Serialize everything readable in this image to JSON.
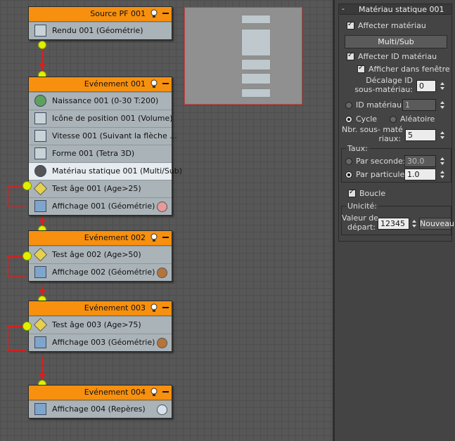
{
  "flow": {
    "events": [
      {
        "title": "Source PF 001",
        "ops": [
          {
            "label": "Rendu 001 (Géométrie)",
            "icon": "render-teapot-icon"
          }
        ]
      },
      {
        "title": "Evénement 001",
        "ops": [
          {
            "label": "Naissance 001 (0-30 T:200)",
            "icon": "birth-icon"
          },
          {
            "label": "Icône de position 001 (Volume)",
            "icon": "position-icon"
          },
          {
            "label": "Vitesse 001 (Suivant la flèche ...",
            "icon": "speed-icon"
          },
          {
            "label": "Forme 001 (Tetra 3D)",
            "icon": "shape-icon"
          },
          {
            "label": "Matériau statique 001 (Multi/Sub)",
            "icon": "material-icon",
            "selected": true
          },
          {
            "label": "Test âge 001 (Age>25)",
            "icon": "age-test-icon"
          },
          {
            "label": "Affichage 001 (Géométrie)",
            "icon": "display-icon",
            "swatch": "#e79a9a"
          }
        ]
      },
      {
        "title": "Evénement 002",
        "ops": [
          {
            "label": "Test âge 002 (Age>50)",
            "icon": "age-test-icon"
          },
          {
            "label": "Affichage 002 (Géométrie)",
            "icon": "display-icon",
            "swatch": "#b5753a"
          }
        ]
      },
      {
        "title": "Evénement 003",
        "ops": [
          {
            "label": "Test âge 003 (Age>75)",
            "icon": "age-test-icon"
          },
          {
            "label": "Affichage 003 (Géométrie)",
            "icon": "display-icon",
            "swatch": "#b5753a"
          }
        ]
      },
      {
        "title": "Evénement 004",
        "ops": [
          {
            "label": "Affichage 004 (Repères)",
            "icon": "display-icon",
            "swatch": "#d6e2ee"
          }
        ]
      }
    ],
    "colors": {
      "header": "#f7900e",
      "wire": "#d62020",
      "node": "#dff000",
      "body": "#aab3b8"
    }
  },
  "panel": {
    "title": "Matériau statique 001",
    "collapse": "-",
    "assign_material": {
      "label": "Affecter matériau",
      "checked": true
    },
    "material_button": "Multi/Sub",
    "assign_material_id": {
      "label": "Affecter ID matériau",
      "checked": true
    },
    "show_in_viewport": {
      "label": "Afficher dans fenêtre",
      "checked": true
    },
    "submat_offset": {
      "label_1": "Décalage ID",
      "label_2": "sous-matériau:",
      "value": "0"
    },
    "material_id": {
      "label": "ID matériau:",
      "value": "1"
    },
    "cycle": "Cycle",
    "random": "Aléatoire",
    "num_submats": {
      "label_1": "Nbr. sous- maté",
      "label_2": "riaux:",
      "value": "5"
    },
    "rate": {
      "title": "Taux:",
      "per_second": {
        "label": "Par seconde:",
        "value": "30.0"
      },
      "per_particle": {
        "label": "Par particule:",
        "value": "1.0"
      }
    },
    "loop": {
      "label": "Boucle",
      "checked": true
    },
    "uniqueness": {
      "title": "Unicité:",
      "seed_label_1": "Valeur de",
      "seed_label_2": "départ:",
      "seed_value": "12345",
      "new_button": "Nouveau"
    }
  }
}
